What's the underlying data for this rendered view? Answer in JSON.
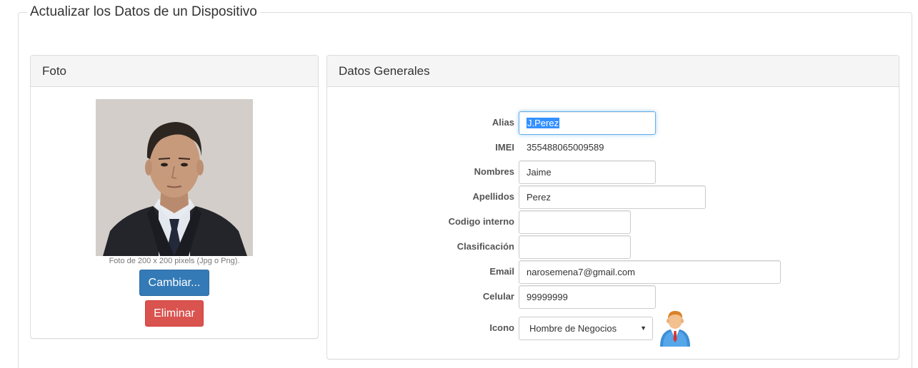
{
  "legend": "Actualizar los Datos de un Dispositivo",
  "foto_panel": {
    "title": "Foto",
    "caption": "Foto de 200 x 200 pixels (Jpg o Png).",
    "change_button": "Cambiar...",
    "delete_button": "Eliminar"
  },
  "datos_panel": {
    "title": "Datos Generales",
    "fields": {
      "alias": {
        "label": "Alias",
        "value": "J.Perez"
      },
      "imei": {
        "label": "IMEI",
        "value": "355488065009589"
      },
      "nombres": {
        "label": "Nombres",
        "value": "Jaime"
      },
      "apellidos": {
        "label": "Apellidos",
        "value": "Perez"
      },
      "codigo": {
        "label": "Codigo interno",
        "value": ""
      },
      "clasificacion": {
        "label": "Clasificación",
        "value": ""
      },
      "email": {
        "label": "Email",
        "value": "narosemena7@gmail.com"
      },
      "celular": {
        "label": "Celular",
        "value": "99999999"
      },
      "icono": {
        "label": "Icono",
        "value": "Hombre de Negocios",
        "icon": "businessman-icon"
      }
    }
  },
  "colors": {
    "primary": "#337ab7",
    "danger": "#d9534f",
    "focus": "#66afe9"
  }
}
